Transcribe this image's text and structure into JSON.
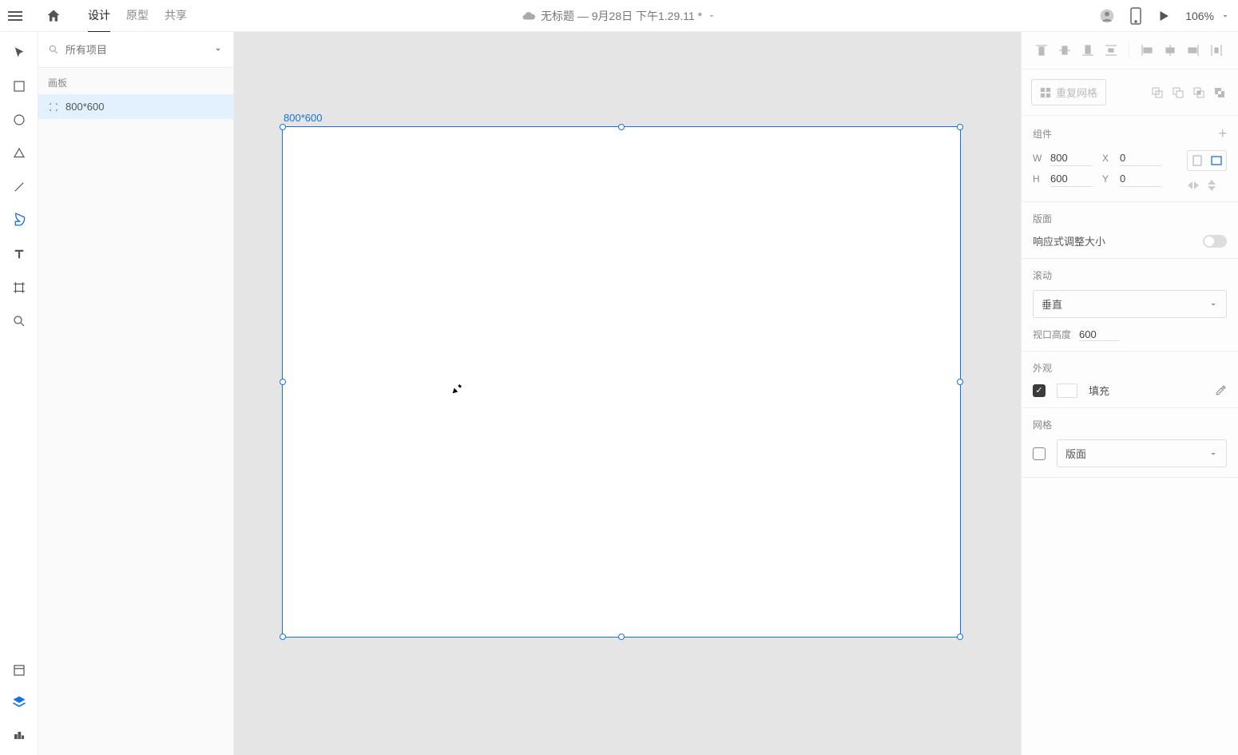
{
  "header": {
    "tabs": {
      "design": "设计",
      "prototype": "原型",
      "share": "共享"
    },
    "title": "无标题 — 9月28日 下午1.29.11 *",
    "zoom": "106%"
  },
  "leftPanel": {
    "search_placeholder": "所有项目",
    "artboards_label": "画板",
    "layer_name": "800*600"
  },
  "canvas": {
    "artboard_label": "800*600"
  },
  "rightPanel": {
    "repeat_grid": "重复网格",
    "component_label": "组件",
    "width_label": "W",
    "width_value": "800",
    "height_label": "H",
    "height_value": "600",
    "x_label": "X",
    "x_value": "0",
    "y_label": "Y",
    "y_value": "0",
    "layout_label": "版面",
    "responsive_label": "响应式调整大小",
    "scroll_label": "滚动",
    "scroll_value": "垂直",
    "viewport_label": "视口高度",
    "viewport_value": "600",
    "appearance_label": "外观",
    "fill_label": "填充",
    "grid_label": "网格",
    "grid_value": "版面"
  }
}
